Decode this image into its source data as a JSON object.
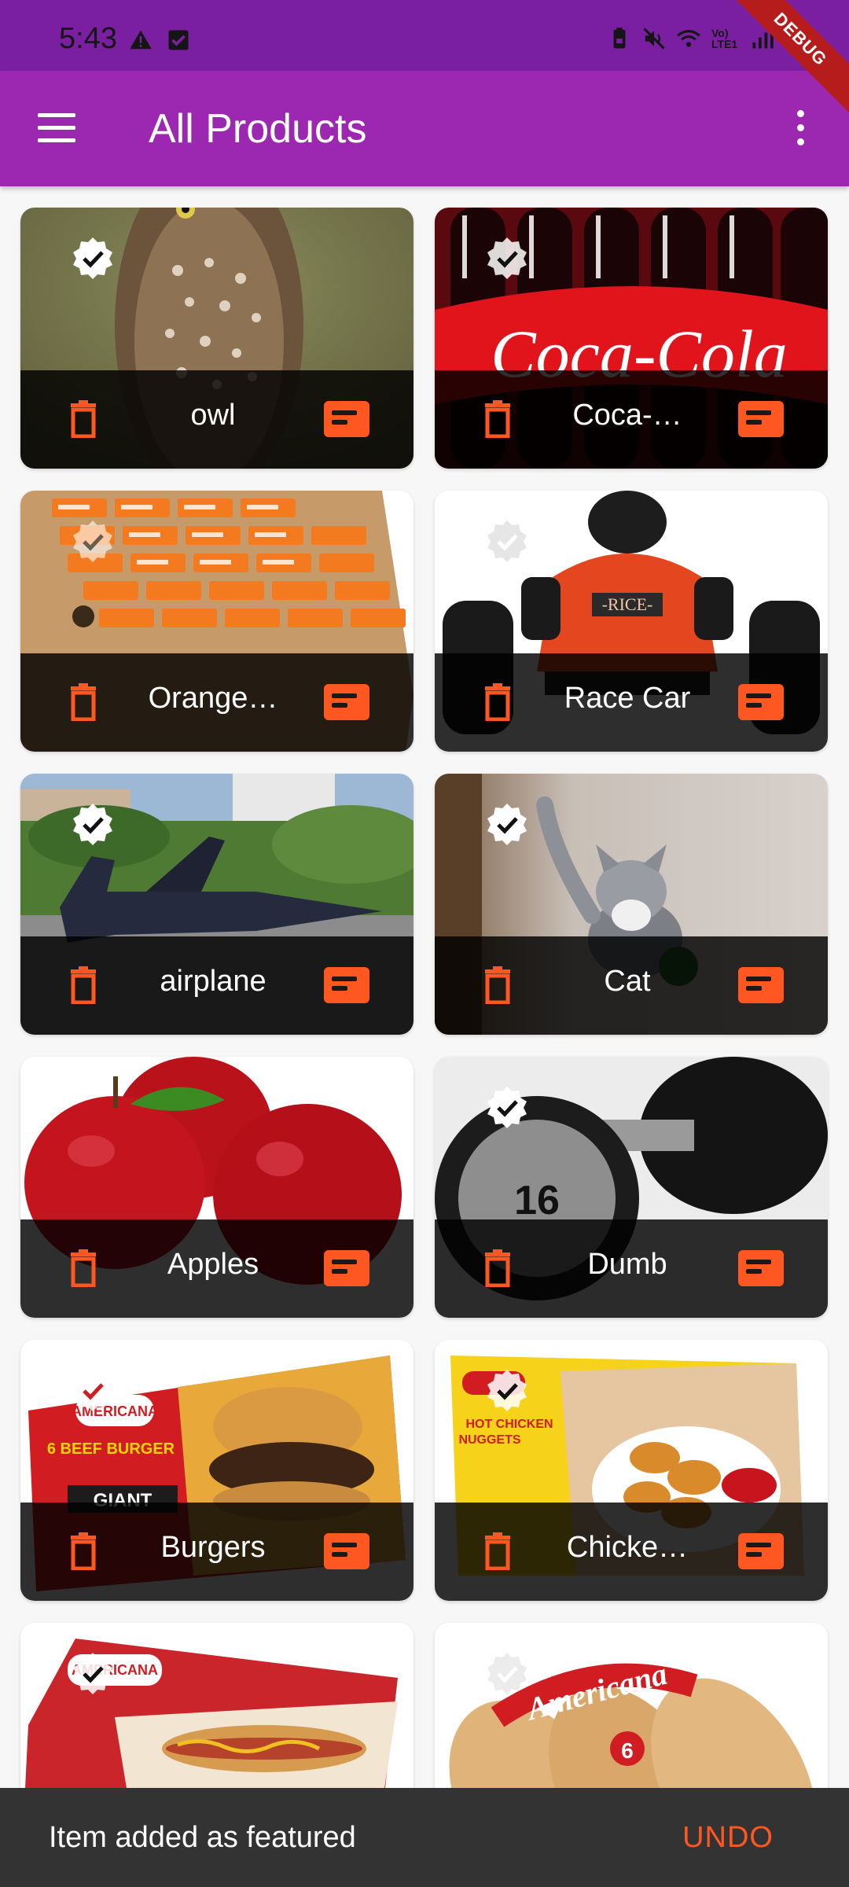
{
  "status_bar": {
    "time": "5:43",
    "left_icons": [
      "warning-icon",
      "checkbox-icon"
    ],
    "right_icons": [
      "battery-lock-icon",
      "mute-icon",
      "wifi-icon",
      "volte-icon",
      "signal-icon"
    ],
    "network_label": "Vo) LTE1"
  },
  "debug_banner": "DEBUG",
  "app_bar": {
    "title": "All Products",
    "menu_icon": "hamburger-menu-icon",
    "overflow_icon": "more-vertical-icon",
    "background": "#9c27b0"
  },
  "products": [
    {
      "name": "owl",
      "featured": true,
      "image": "owl-photo"
    },
    {
      "name": "Coca-…",
      "featured": true,
      "image": "coca-cola-bottles-photo"
    },
    {
      "name": "Orange…",
      "featured": true,
      "image": "orange-juice-boxes-photo"
    },
    {
      "name": "Race Car",
      "featured": true,
      "image": "race-car-photo"
    },
    {
      "name": "airplane",
      "featured": true,
      "image": "airplane-photo"
    },
    {
      "name": "Cat",
      "featured": true,
      "image": "kitten-photo"
    },
    {
      "name": "Apples",
      "featured": false,
      "image": "red-apples-photo"
    },
    {
      "name": "Dumb",
      "featured": true,
      "image": "dumbbell-photo"
    },
    {
      "name": "Burgers",
      "featured": true,
      "image": "burger-box-photo"
    },
    {
      "name": "Chicke…",
      "featured": true,
      "image": "chicken-nuggets-box-photo"
    },
    {
      "name": "",
      "featured": true,
      "image": "hot-dog-pack-photo"
    },
    {
      "name": "",
      "featured": true,
      "image": "bread-rolls-pack-photo"
    }
  ],
  "card_actions": {
    "delete_icon": "trash-icon",
    "feature_icon": "featured-card-icon",
    "accent": "#ff5722"
  },
  "snackbar": {
    "message": "Item added as featured",
    "action": "UNDO"
  }
}
